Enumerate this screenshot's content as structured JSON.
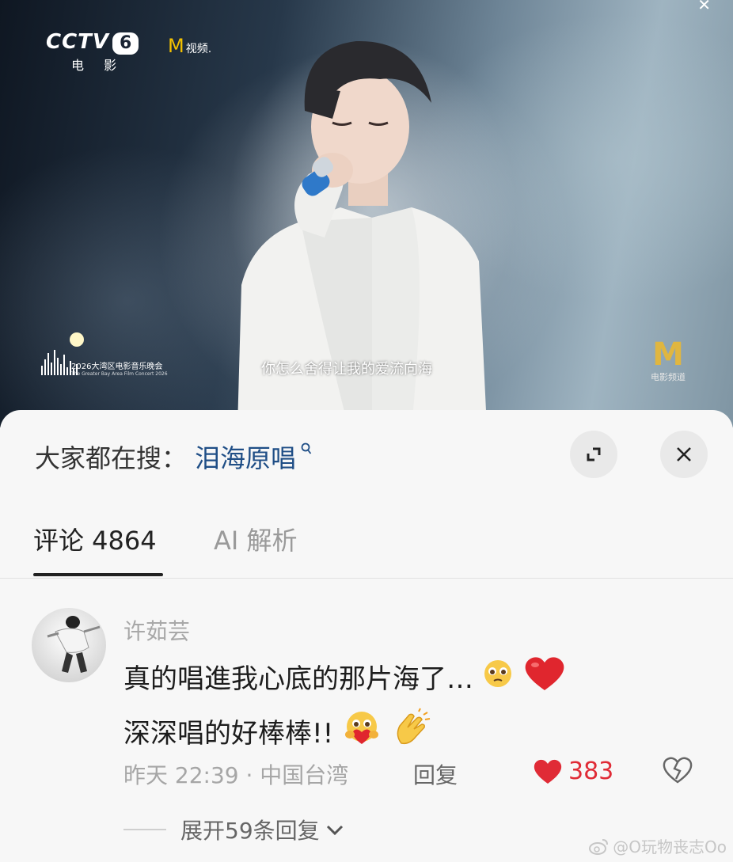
{
  "video": {
    "channel_logo": "CCTV",
    "channel_number": "6",
    "channel_sub": "电 影",
    "platform_logo_mark": "M",
    "platform_logo_text": "视频.",
    "subtitle": "你怎么舍得让我的爱流向海",
    "event_logo_text": "2026大湾区电影音乐晚会",
    "event_logo_subtext": "The Greater Bay Area Film Concert 2026",
    "movie_logo_mark": "M",
    "movie_logo_text": "电影频道"
  },
  "search": {
    "prefix": "大家都在搜：",
    "keyword": "泪海原唱",
    "keyword_icon": "search-icon"
  },
  "buttons": {
    "expand_icon": "expand-icon",
    "close_icon": "close-icon"
  },
  "tabs": [
    {
      "label": "评论 4864",
      "active": true
    },
    {
      "label": "AI 解析",
      "active": false
    }
  ],
  "comment": {
    "username": "许茹芸",
    "line1": "真的唱進我心底的那片海了…",
    "line1_emojis": [
      "pleading-face-emoji",
      "red-heart-emoji"
    ],
    "line2": "深深唱的好棒棒!!",
    "line2_emojis": [
      "hugging-heart-face-emoji",
      "clapping-hands-emoji"
    ],
    "meta": "昨天 22:39 · 中国台湾",
    "reply_label": "回复",
    "like_count": "383",
    "like_icon": "heart-icon",
    "dislike_icon": "broken-heart-icon",
    "expand_replies": "展开59条回复"
  },
  "watermark": {
    "icon": "weibo-icon",
    "text": "@O玩物丧志Oo"
  },
  "colors": {
    "keyword": "#1f4e86",
    "like": "#e02b36",
    "sheet_bg": "#f7f7f7"
  }
}
